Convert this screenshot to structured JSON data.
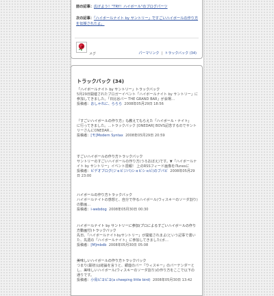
{
  "nav": {
    "prev_label": "前の記事：",
    "prev_link": "広げよう！\"TRY！ハイボール\"のブログパーツ",
    "next_label": "次の記事：",
    "next_link": "「ハイボールナイト by サントリー」ですごいハイボールの作り方を伝授されたよ。"
  },
  "author": {
    "name": "メグ"
  },
  "permalink": {
    "label": "パーマリンク",
    "trackback_link": "トラックバック (34)"
  },
  "trackbacks": {
    "title": "トラックバック (34)",
    "posted_by_label": "投稿者：",
    "items": [
      {
        "title": "「ハイボールナイト by サントリー」トラックバック",
        "excerpt": "5月29日開催されたブロガーイベント「ハイボールナイト by サントリー」に参加してきました。「日比谷バー THE GRAND BAR」が会場…",
        "author": "おしゃれに、ららら",
        "date": "2008年05月29日 18:56"
      },
      {
        "title": "『すごいハイボールの作り方』も教えてもらえた「ハイボール・ナイト」",
        "excerpt": "に行ってきました。…トラックバック [ONEDAR] BOVS記念するのでサントリーさんにONEDAR…",
        "author": "[モ]Modern Syntax",
        "date": "2008年05月29日 20:59"
      },
      {
        "title": "すごいハイボールの作り方トラックバック",
        "excerpt": "サントリーのすごいハイボールの作り方(うろおぼえ)です。▼「ハイボールナイト by サントリー」イベント週報！ 上のRSSフィード画像をiTunesに",
        "author": "ビデオブログ(ジョビジバ)ショビショビ(のブバビ",
        "date": "2008年05月29日 23:00"
      },
      {
        "title": "ハイボールの作り方トラックバック",
        "excerpt": "ハイボールナイトの感想と、自分で作るハイボール(ウィスキーのソーダ割り)の動画…",
        "author": "i-webdog",
        "date": "2008年05月30日 00:30"
      },
      {
        "title": "ハイボールナイト by サントリーに参加(プロによるすごいハイボールの作り方動画付)トラックバック",
        "excerpt": "先日、「ハイボールナイトbyサントリー」が開催されまよ(という記事で書いた、先週の「ハイボールナイト」に参加してきました(ボ…",
        "author": "[M]mbdb",
        "date": "2008年05月30日 05:08"
      },
      {
        "title": "美味しいハイボールの作り方トラックバック",
        "excerpt": "つまり(最初)は結論を言うと、銀座のバー「ウィスキー」のバーテンダーとし、美味しいハイボール(ウィスキーのソーダ割り)の作り方をここで以下の通りです。",
        "author": "小鳥ピヨピヨ(a cheeping little bird)",
        "date": "2008年05月30日 13:42"
      }
    ]
  }
}
